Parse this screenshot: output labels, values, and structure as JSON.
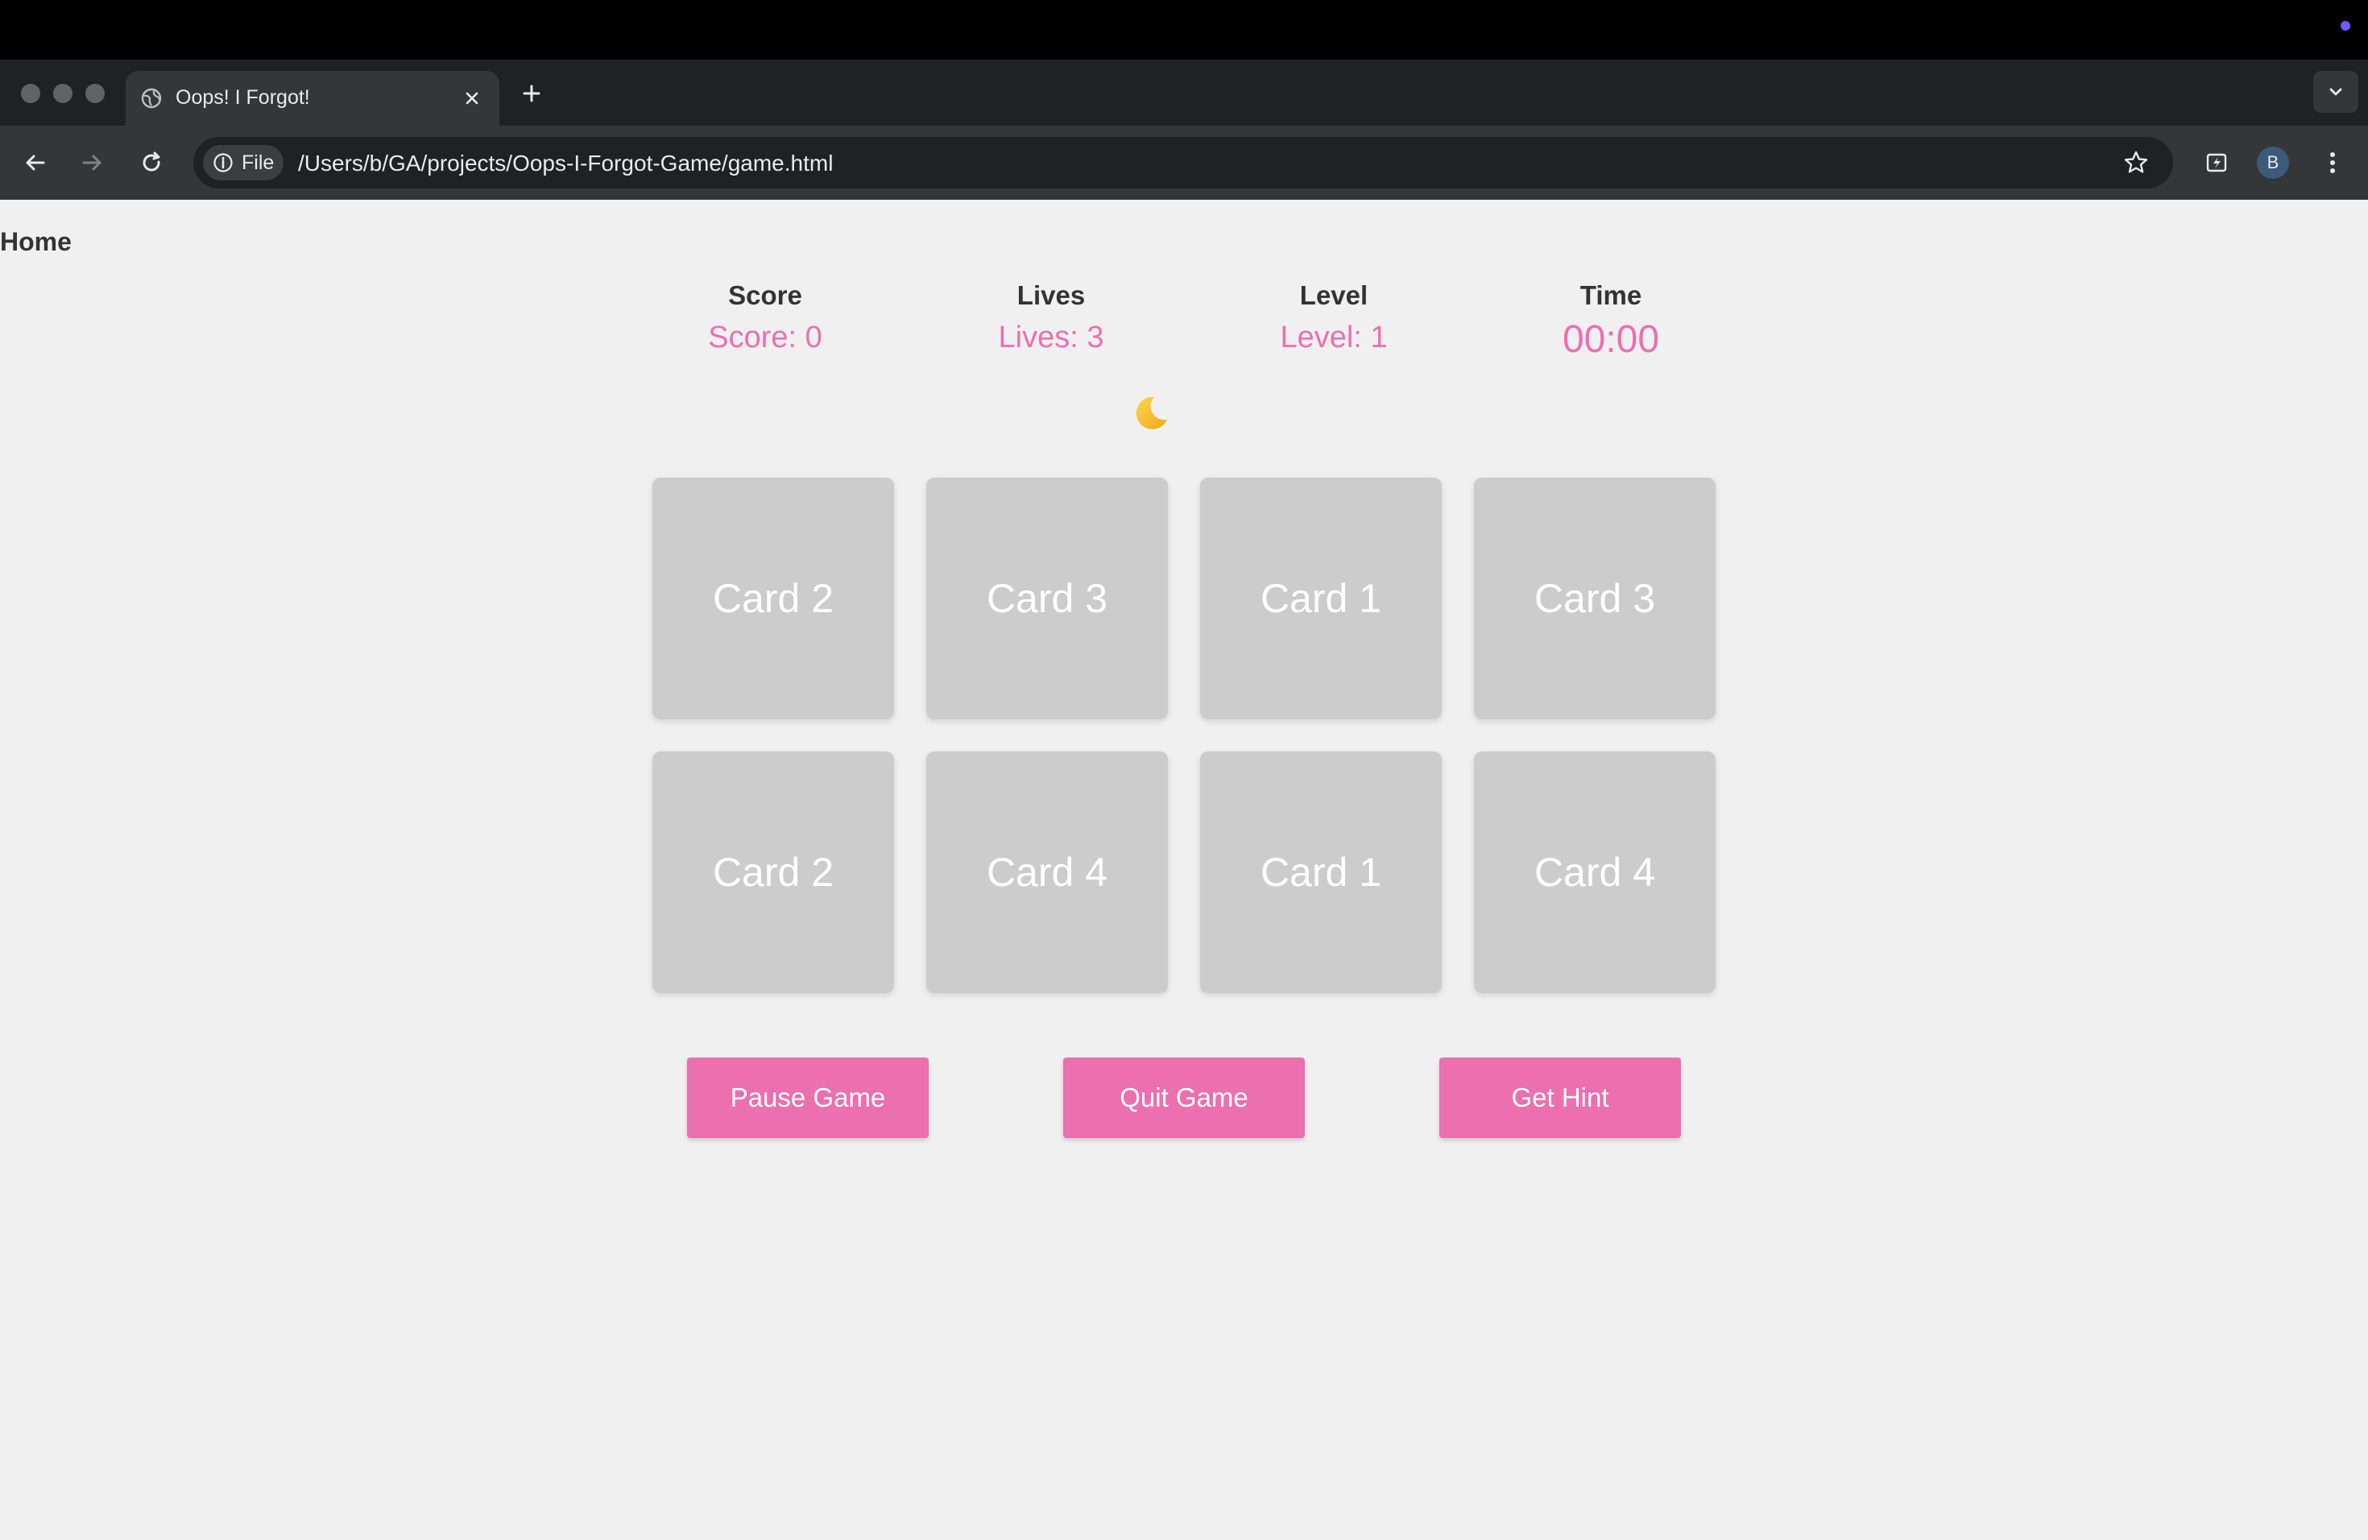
{
  "browser": {
    "tab_title": "Oops! I Forgot!",
    "chip_label": "File",
    "url": "/Users/b/GA/projects/Oops-I-Forgot-Game/game.html",
    "avatar_letter": "B"
  },
  "nav": {
    "home_label": "Home"
  },
  "stats": {
    "score_label": "Score",
    "score_value": "Score: 0",
    "lives_label": "Lives",
    "lives_value": "Lives: 3",
    "level_label": "Level",
    "level_value": "Level: 1",
    "time_label": "Time",
    "time_value": "00:00"
  },
  "theme_toggle_icon": "crescent-moon-icon",
  "cards": [
    {
      "label": "Card 2"
    },
    {
      "label": "Card 3"
    },
    {
      "label": "Card 1"
    },
    {
      "label": "Card 3"
    },
    {
      "label": "Card 2"
    },
    {
      "label": "Card 4"
    },
    {
      "label": "Card 1"
    },
    {
      "label": "Card 4"
    }
  ],
  "controls": {
    "pause_label": "Pause Game",
    "quit_label": "Quit Game",
    "hint_label": "Get Hint"
  },
  "colors": {
    "accent": "#ec6fb0",
    "card_back": "#cccccc",
    "page_bg": "#f0f0f0"
  }
}
